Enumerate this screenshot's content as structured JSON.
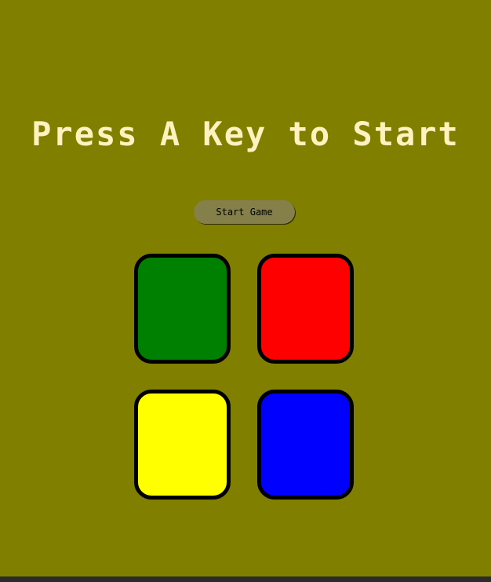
{
  "game": {
    "title": "Press A Key to Start",
    "start_button_label": "Start Game"
  },
  "pads": [
    {
      "color_name": "green",
      "color": "#008000"
    },
    {
      "color_name": "red",
      "color": "#ff0000"
    },
    {
      "color_name": "yellow",
      "color": "#ffff00"
    },
    {
      "color_name": "blue",
      "color": "#0000ff"
    }
  ],
  "theme": {
    "background": "#807f00",
    "title_color": "#fef2bf",
    "button_background": "#85804a"
  }
}
